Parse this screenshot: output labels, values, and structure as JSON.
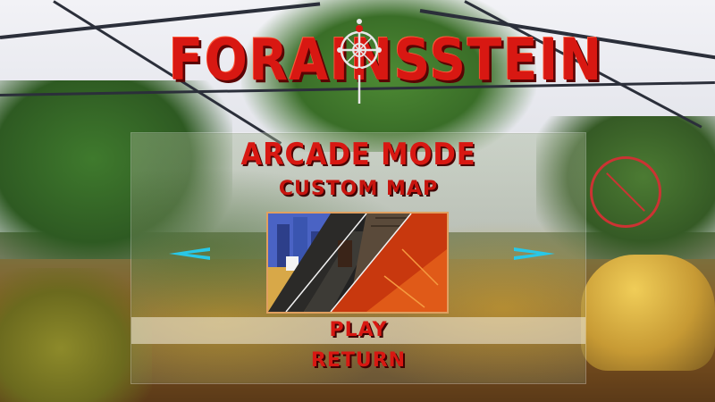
{
  "game": {
    "logo_text": "FORAINSSTEIN",
    "emblem_icon": "cross-wheel-emblem-icon"
  },
  "menu": {
    "title": "ARCADE MODE",
    "map_name": "CUSTOM MAP",
    "prev_arrow_icon": "arrow-left-icon",
    "next_arrow_icon": "arrow-right-icon",
    "map_preview_icon": "map-preview-thumbnail",
    "play_label": "PLAY",
    "return_label": "RETURN"
  },
  "colors": {
    "title_red": "#d81812",
    "arrow_cyan": "#28c8e8",
    "thumb_border": "#e0a060"
  }
}
